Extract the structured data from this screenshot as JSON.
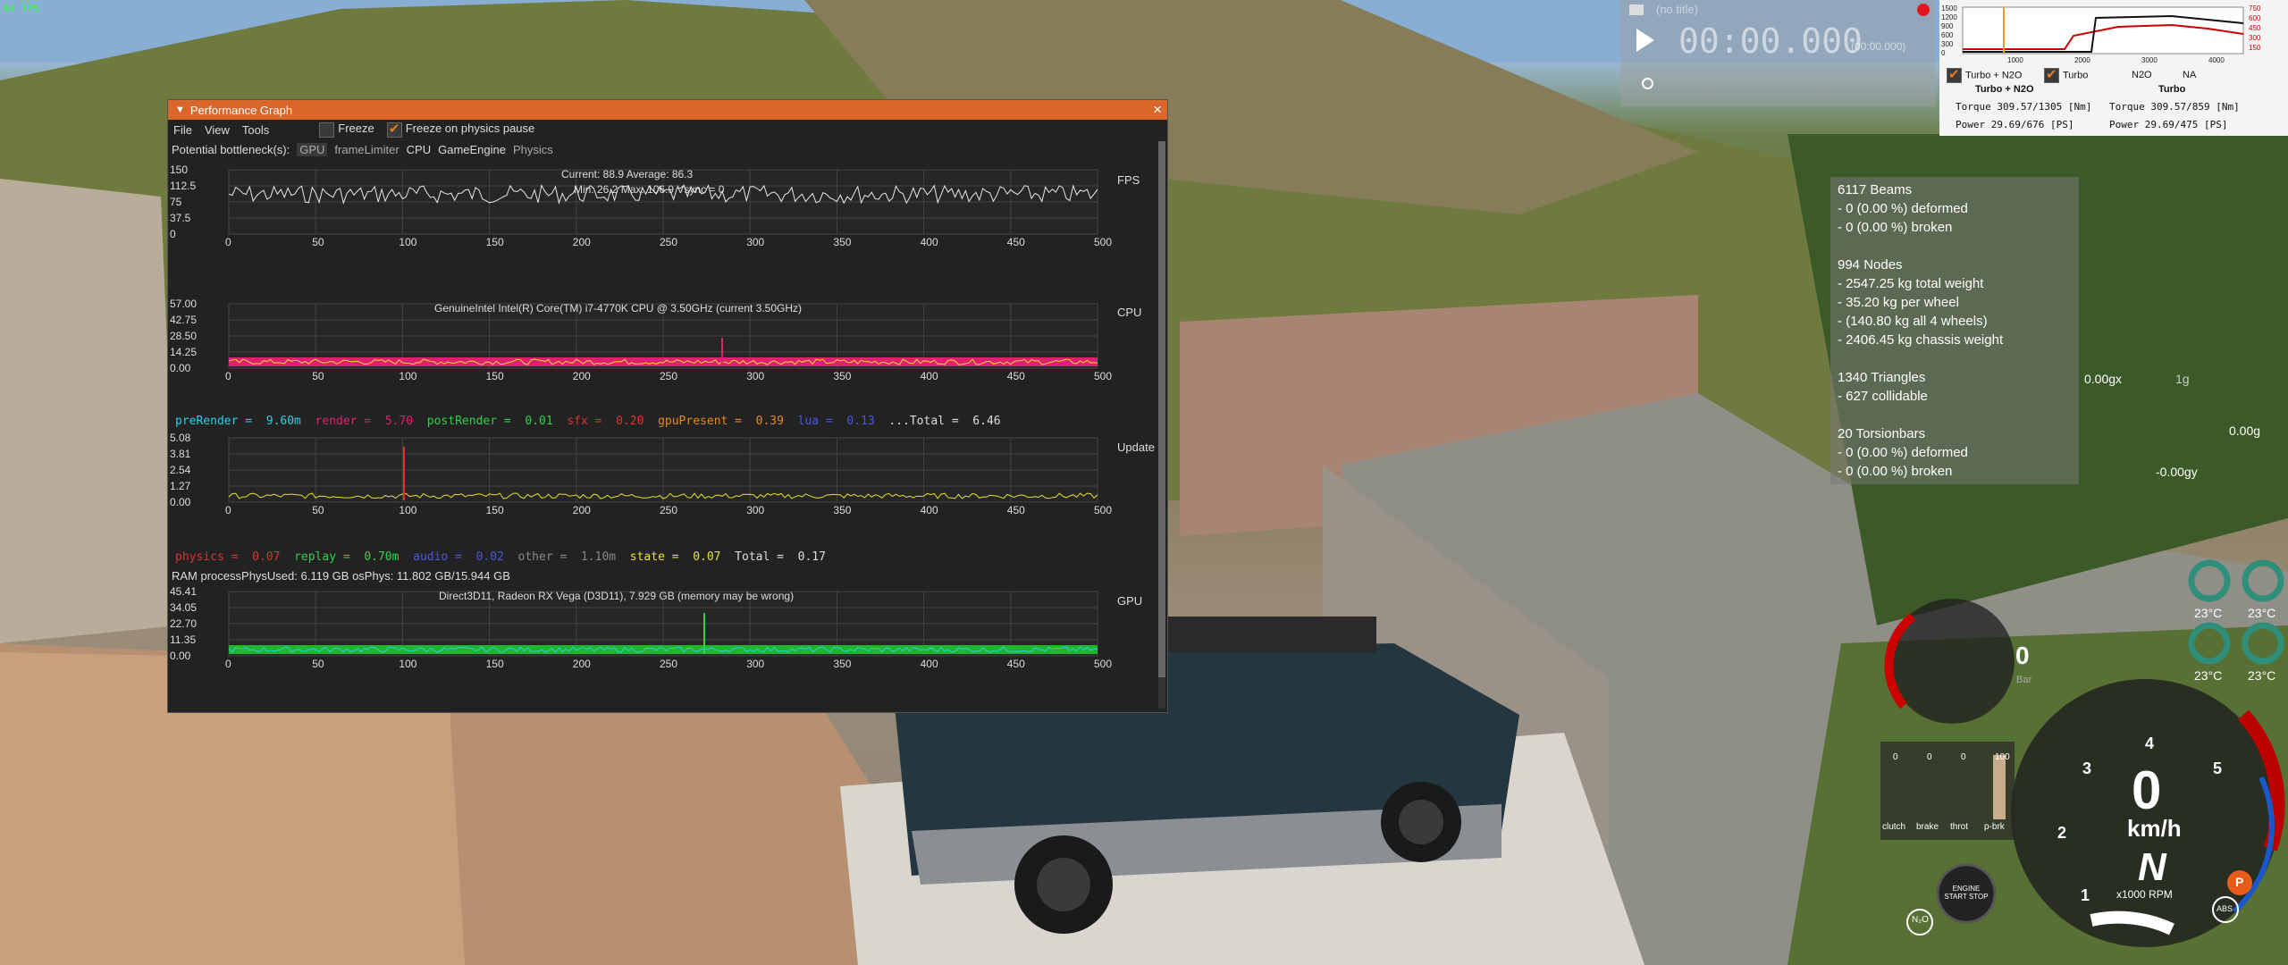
{
  "fps_overlay": "64 FPS",
  "window": {
    "title": "Performance Graph",
    "close": "×",
    "menu": [
      "File",
      "View",
      "Tools"
    ],
    "freeze": "Freeze",
    "freeze_physics": "Freeze on physics pause",
    "bottleneck_label": "Potential bottleneck(s):",
    "bottlenecks": [
      "GPU",
      "frameLimiter",
      "CPU",
      "GameEngine",
      "Physics"
    ],
    "ram_text": "RAM  processPhysUsed: 6.119 GB  osPhys: 11.802 GB/15.944 GB"
  },
  "graphs": [
    {
      "side": "FPS",
      "y_ticks": [
        "150",
        "112.5",
        "75",
        "37.5",
        "0"
      ],
      "x_ticks": [
        "0",
        "50",
        "100",
        "150",
        "200",
        "250",
        "300",
        "350",
        "400",
        "450",
        "500"
      ],
      "info1": "Current: 88.9    Average: 86.3",
      "info2": "Min: 26.2   Max: 106.9  Vsync = 0"
    },
    {
      "side": "CPU",
      "y_ticks": [
        "57.00",
        "42.75",
        "28.50",
        "14.25",
        "0.00"
      ],
      "x_ticks": [
        "0",
        "50",
        "100",
        "150",
        "200",
        "250",
        "300",
        "350",
        "400",
        "450",
        "500"
      ],
      "info1": "GenuineIntel Intel(R) Core(TM) i7-4770K CPU @ 3.50GHz (current 3.50GHz)",
      "info2": ""
    },
    {
      "side": "Update",
      "y_ticks": [
        "5.08",
        "3.81",
        "2.54",
        "1.27",
        "0.00"
      ],
      "x_ticks": [
        "0",
        "50",
        "100",
        "150",
        "200",
        "250",
        "300",
        "350",
        "400",
        "450",
        "500"
      ],
      "info1": "",
      "info2": ""
    },
    {
      "side": "GPU",
      "y_ticks": [
        "45.41",
        "34.05",
        "22.70",
        "11.35",
        "0.00"
      ],
      "x_ticks": [
        "0",
        "50",
        "100",
        "150",
        "200",
        "250",
        "300",
        "350",
        "400",
        "450",
        "500"
      ],
      "info1": "Direct3D11, Radeon RX Vega (D3D11), 7.929 GB (memory may be wrong)",
      "info2": ""
    }
  ],
  "cpu_legend": [
    {
      "k": "preRender =",
      "v": "9.60m",
      "c": "#29d0e6"
    },
    {
      "k": "render =",
      "v": "5.70",
      "c": "#e0206e"
    },
    {
      "k": "postRender =",
      "v": "0.01",
      "c": "#2fd24a"
    },
    {
      "k": "sfx =",
      "v": "0.20",
      "c": "#d8362c"
    },
    {
      "k": "gpuPresent =",
      "v": "0.39",
      "c": "#e58a1e"
    },
    {
      "k": "lua =",
      "v": "0.13",
      "c": "#4b55e0"
    },
    {
      "k": "...Total =",
      "v": "6.46",
      "c": "#dddddd"
    }
  ],
  "update_legend": [
    {
      "k": "physics =",
      "v": "0.07",
      "c": "#d8362c"
    },
    {
      "k": "replay =",
      "v": "0.70m",
      "c": "#2fd24a"
    },
    {
      "k": "audio =",
      "v": "0.02",
      "c": "#4b55e0"
    },
    {
      "k": "other =",
      "v": "1.10m",
      "c": "#888888"
    },
    {
      "k": "state =",
      "v": "0.07",
      "c": "#e8e030"
    },
    {
      "k": "Total =",
      "v": "0.17",
      "c": "#dddddd"
    }
  ],
  "timer": {
    "label": "(no title)",
    "time": "00:00.000",
    "sub": "(00:00.000)"
  },
  "torque": {
    "y_ticks": [
      "1500",
      "1200",
      "900",
      "600",
      "300",
      "0"
    ],
    "y2_ticks": [
      "750",
      "600",
      "450",
      "300",
      "150"
    ],
    "x_ticks": [
      "1000",
      "2000",
      "3000",
      "4000"
    ],
    "left_check1": "Turbo + N2O",
    "left_check2": "Turbo",
    "left_sub": "Turbo + N2O",
    "right_h1": "N2O",
    "right_h2": "NA",
    "right_sub": "Turbo",
    "left_torque": "Torque 309.57/1305 [Nm]",
    "left_power": "Power  29.69/676  [PS]",
    "right_torque": "Torque 309.57/859 [Nm]",
    "right_power": "Power  29.69/475  [PS]"
  },
  "stats": [
    "6117 Beams",
    "- 0 (0.00 %) deformed",
    "- 0 (0.00 %) broken",
    "",
    "994 Nodes",
    "- 2547.25 kg total weight",
    "- 35.20 kg per wheel",
    "- (140.80 kg all 4 wheels)",
    "- 2406.45 kg chassis weight",
    "",
    "1340 Triangles",
    "- 627 collidable",
    "",
    "20 Torsionbars",
    "- 0 (0.00 %) deformed",
    "- 0 (0.00 %) broken"
  ],
  "gforce": {
    "gx": "0.00gx",
    "g": "0.00g",
    "gy": "-0.00gy",
    "one_g": "1g"
  },
  "dash": {
    "speed": "0",
    "unit": "km/h",
    "gear": "N",
    "rpm_label": "x1000 RPM",
    "boost": "0",
    "boost_unit": "Bar",
    "gauge_nums": [
      "3",
      "4",
      "5",
      "2",
      "1"
    ],
    "temps": [
      "23°C",
      "23°C",
      "23°C",
      "23°C"
    ],
    "pedals": [
      "clutch",
      "brake",
      "throt",
      "p-brk"
    ],
    "pedal_vals": [
      "0",
      "0",
      "0",
      "100"
    ],
    "engine_btn": "ENGINE START STOP",
    "nos": "N₂O",
    "abs": "ABS",
    "p": "P"
  },
  "colors": {
    "accent": "#d9662b",
    "cpu_render": "#e0206e",
    "fps_line": "#e8e8e8",
    "gpu_green": "#1fb52c",
    "gpu_cyan": "#29d0e6"
  }
}
